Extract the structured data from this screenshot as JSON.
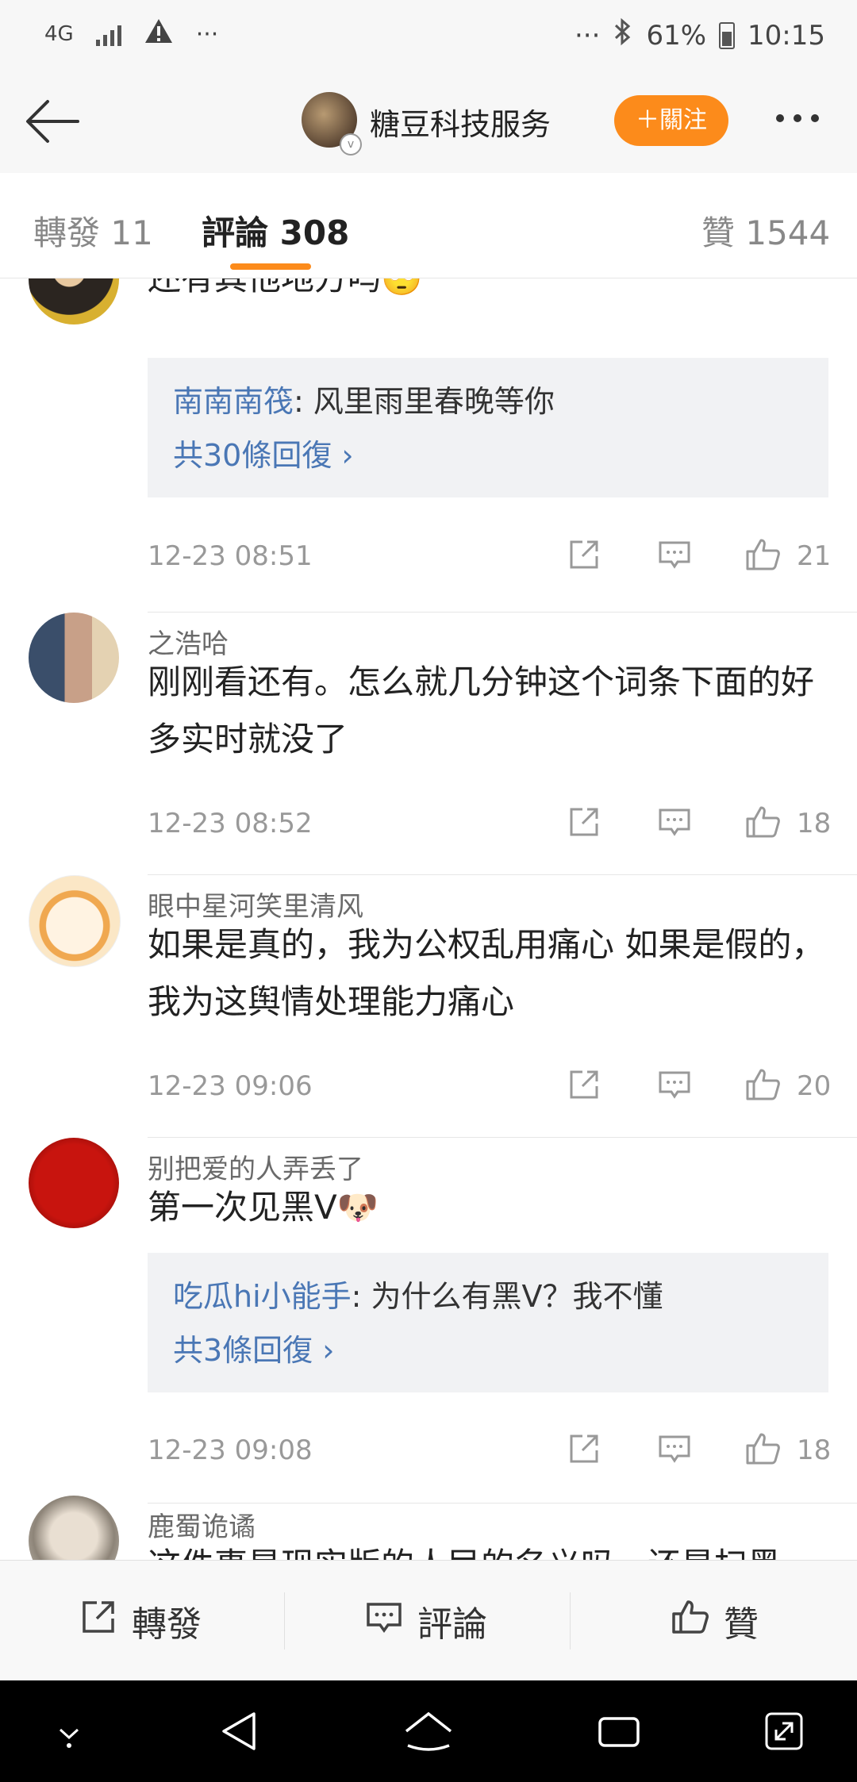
{
  "status_bar": {
    "network": "4G",
    "battery": "61%",
    "time": "10:15",
    "left_dots": "···",
    "right_dots": "···"
  },
  "nav": {
    "title": "糖豆科技服务",
    "follow_label": "＋關注",
    "accent_color": "#fc8b1b"
  },
  "tabs": [
    {
      "label": "轉發 11"
    },
    {
      "label": "評論 308"
    },
    {
      "label": "贊 1544"
    }
  ],
  "comments": [
    {
      "username": "",
      "text": "还有其他地方吗🙄",
      "reply": {
        "name": "南南南筏",
        "text": ": 风里雨里春晚等你",
        "more": "共30條回復 ›"
      },
      "time": "12-23 08:51",
      "likes": "21"
    },
    {
      "username": "之浩哈",
      "text": "刚刚看还有。怎么就几分钟这个词条下面的好多实时就没了",
      "time": "12-23 08:52",
      "likes": "18"
    },
    {
      "username": "眼中星河笑里清风",
      "text": "如果是真的，我为公权乱用痛心 如果是假的，我为这舆情处理能力痛心",
      "time": "12-23 09:06",
      "likes": "20"
    },
    {
      "username": "别把爱的人弄丢了",
      "text": "第一次见黑V🐶",
      "reply": {
        "name": "吃瓜hi小能手",
        "text": ": 为什么有黑V？我不懂",
        "more": "共3條回復 ›"
      },
      "time": "12-23 09:08",
      "likes": "18"
    },
    {
      "username": "鹿蜀诡谲",
      "text": "这件事是现实版的人民的名义吗，还是扫黑"
    }
  ],
  "bottom_bar": {
    "repost_label": "轉發",
    "comment_label": "評論",
    "like_label": "贊"
  }
}
